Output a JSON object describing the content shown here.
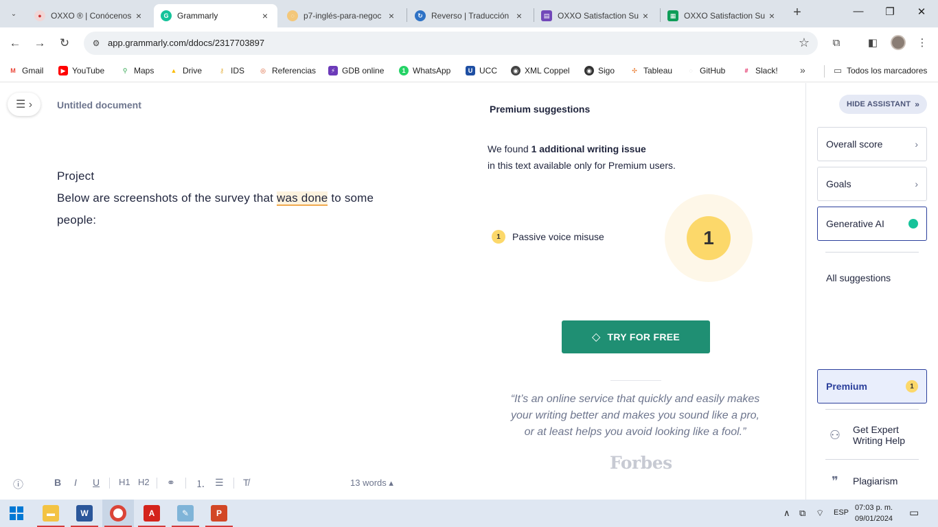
{
  "browser": {
    "tabs": [
      {
        "title": "OXXO ® | Conócenos",
        "favicon_color": "#e8e8e8",
        "favicon_text": "OX"
      },
      {
        "title": "Grammarly",
        "favicon_color": "#15c39a",
        "favicon_text": "G"
      },
      {
        "title": "p7-inglés-para-negoc",
        "favicon_color": "#f4b04a",
        "favicon_text": "p"
      },
      {
        "title": "Reverso | Traducción",
        "favicon_color": "#2e72c5",
        "favicon_text": "R"
      },
      {
        "title": "OXXO Satisfaction Su",
        "favicon_color": "#7248b9",
        "favicon_text": "▤"
      },
      {
        "title": "OXXO Satisfaction Su",
        "favicon_color": "#0f9d58",
        "favicon_text": "▦"
      }
    ],
    "url": "app.grammarly.com/ddocs/2317703897",
    "bookmarks": [
      {
        "label": "Gmail",
        "color": "#ea4335",
        "glyph": "M"
      },
      {
        "label": "YouTube",
        "color": "#ff0000",
        "glyph": "▶"
      },
      {
        "label": "Maps",
        "color": "#34a853",
        "glyph": "⚲"
      },
      {
        "label": "Drive",
        "color": "#fbbc04",
        "glyph": "△"
      },
      {
        "label": "IDS",
        "color": "#e6b54a",
        "glyph": "⚷"
      },
      {
        "label": "Referencias",
        "color": "#d8572a",
        "glyph": "◎"
      },
      {
        "label": "GDB online",
        "color": "#6c3ab9",
        "glyph": "⚡"
      },
      {
        "label": "WhatsApp",
        "color": "#25d366",
        "glyph": "1"
      },
      {
        "label": "UCC",
        "color": "#1e4fa3",
        "glyph": "U"
      },
      {
        "label": "XML Coppel",
        "color": "#444444",
        "glyph": "◉"
      },
      {
        "label": "Sigo",
        "color": "#333333",
        "glyph": "◉"
      },
      {
        "label": "Tableau",
        "color": "#e97627",
        "glyph": "✣"
      },
      {
        "label": "GitHub",
        "color": "#e6e6e6",
        "glyph": " "
      },
      {
        "label": "Slack!",
        "color": "#e01e5a",
        "glyph": "#"
      }
    ],
    "bookmarks_more": "»",
    "all_bookmarks": "Todos los marcadores"
  },
  "editor": {
    "doc_title": "Untitled document",
    "lines": {
      "heading": "Project",
      "line2_before": "Below are screenshots of the survey that ",
      "line2_highlight": "was done",
      "line2_after": " to some",
      "line3": "people:"
    },
    "word_count": "13 words ▴",
    "format_tools": [
      "?",
      "B",
      "I",
      "U",
      "H1",
      "H2",
      "🔗",
      "≡",
      "☰",
      "T̸"
    ]
  },
  "premium": {
    "heading": "Premium suggestions",
    "found_prefix": "We found ",
    "found_bold": "1 additional writing issue",
    "found_suffix": "in this text available only for Premium users.",
    "issue_count": "1",
    "issue_label": "Passive voice misuse",
    "big_count": "1",
    "try_button": "TRY FOR FREE",
    "quote": "“It’s an online service that quickly and easily makes your writing better and makes you sound like a pro, or at least helps you avoid looking like a fool.”",
    "quote_source": "Forbes"
  },
  "sidebar": {
    "hide_assistant": "HIDE ASSISTANT",
    "overall_score": "Overall score",
    "goals": "Goals",
    "generative_ai": "Generative AI",
    "all_suggestions": "All suggestions",
    "premium": "Premium",
    "premium_badge": "1",
    "expert_help": "Get Expert Writing Help",
    "plagiarism": "Plagiarism"
  },
  "taskbar": {
    "lang": "ESP",
    "time": "07:03 p. m.",
    "date": "09/01/2024"
  }
}
